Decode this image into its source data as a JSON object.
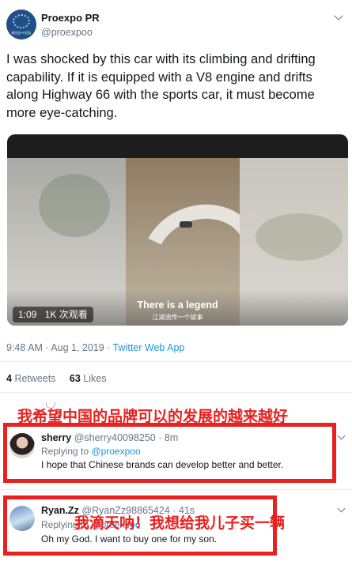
{
  "tweet": {
    "author_name": "Proexpo PR",
    "author_handle": "@proexpoo",
    "avatar_text": "博览会PR团队",
    "text": "I was shocked by this car with its climbing and drifting capability. If it is equipped with a V8 engine and drifts along Highway 66 with the sports car, it must become more eye-catching.",
    "video": {
      "duration": "1:09",
      "views": "1K 次观看",
      "caption_main": "There is a legend",
      "caption_sub": "江湖流传一个故事"
    },
    "timestamp": "9:48 AM · Aug 1, 2019 · ",
    "source_app": "Twitter Web App",
    "retweets_count": "4",
    "retweets_label": "Retweets",
    "likes_count": "63",
    "likes_label": "Likes"
  },
  "annotations": {
    "first": "我希望中国的品牌可以的发展的越来越好",
    "second": "我滴天呐！我想给我儿子买一辆"
  },
  "replies": [
    {
      "name": "sherry",
      "handle_time": "@sherry40098250 · 8m",
      "replying_label": "Replying to",
      "replying_handle": "@proexpoo",
      "text": "I hope that Chinese brands can develop better and better."
    },
    {
      "name": "Ryan.Zz",
      "handle_time": "@RyanZz98865424 · 41s",
      "replying_label": "Replying to",
      "replying_handle": "@proexpoo",
      "text": "Oh my God. I want to buy one for my son."
    }
  ],
  "colors": {
    "accent": "#1b95e0",
    "annotation_red": "#e8201f",
    "muted": "#657786"
  },
  "icons": [
    "chevron-down-icon",
    "reply-icon"
  ]
}
